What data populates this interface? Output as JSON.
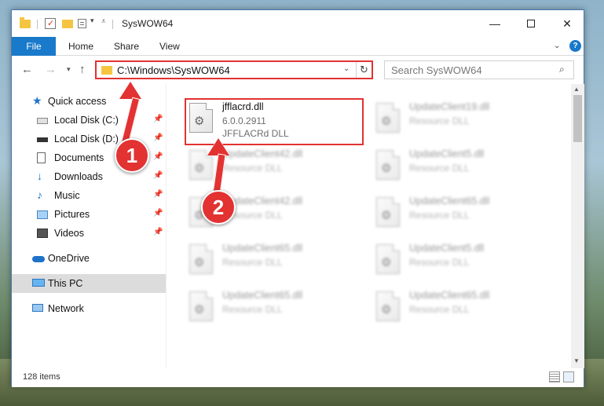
{
  "window": {
    "title": "SysWOW64",
    "minimize": "—",
    "close": "✕"
  },
  "ribbon": {
    "file": "File",
    "home": "Home",
    "share": "Share",
    "view": "View",
    "help": "?"
  },
  "address": {
    "path": "C:\\Windows\\SysWOW64",
    "search_placeholder": "Search SysWOW64"
  },
  "nav": {
    "quick_access": "Quick access",
    "items": [
      {
        "label": "Local Disk (C:)",
        "icon": "drive-icon"
      },
      {
        "label": "Local Disk (D:)",
        "icon": "drive-icon"
      },
      {
        "label": "Documents",
        "icon": "documents-icon"
      },
      {
        "label": "Downloads",
        "icon": "downloads-icon"
      },
      {
        "label": "Music",
        "icon": "music-icon"
      },
      {
        "label": "Pictures",
        "icon": "pictures-icon"
      },
      {
        "label": "Videos",
        "icon": "videos-icon"
      }
    ],
    "onedrive": "OneDrive",
    "this_pc": "This PC",
    "network": "Network"
  },
  "files": [
    {
      "name": "jfflacrd.dll",
      "version": "6.0.0.2911",
      "desc": "JFFLACRd DLL"
    },
    {
      "name": "UpdateClient19.dll",
      "version": "Resource DLL"
    },
    {
      "name": "UpdateClient42.dll",
      "version": "Resource DLL"
    },
    {
      "name": "UpdateClient5.dll",
      "version": "Resource DLL"
    },
    {
      "name": "UpdateClient42.dll",
      "version": "Resource DLL"
    },
    {
      "name": "UpdateClient65.dll",
      "version": "Resource DLL"
    },
    {
      "name": "UpdateClient65.dll",
      "version": "Resource DLL"
    },
    {
      "name": "UpdateClient5.dll",
      "version": "Resource DLL"
    },
    {
      "name": "UpdateClient65.dll",
      "version": "Resource DLL"
    },
    {
      "name": "UpdateClient65.dll",
      "version": "Resource DLL"
    }
  ],
  "status": {
    "count": "128 items"
  },
  "callouts": {
    "one": "1",
    "two": "2"
  },
  "colors": {
    "accent": "#1979ca",
    "highlight": "#e23232"
  }
}
